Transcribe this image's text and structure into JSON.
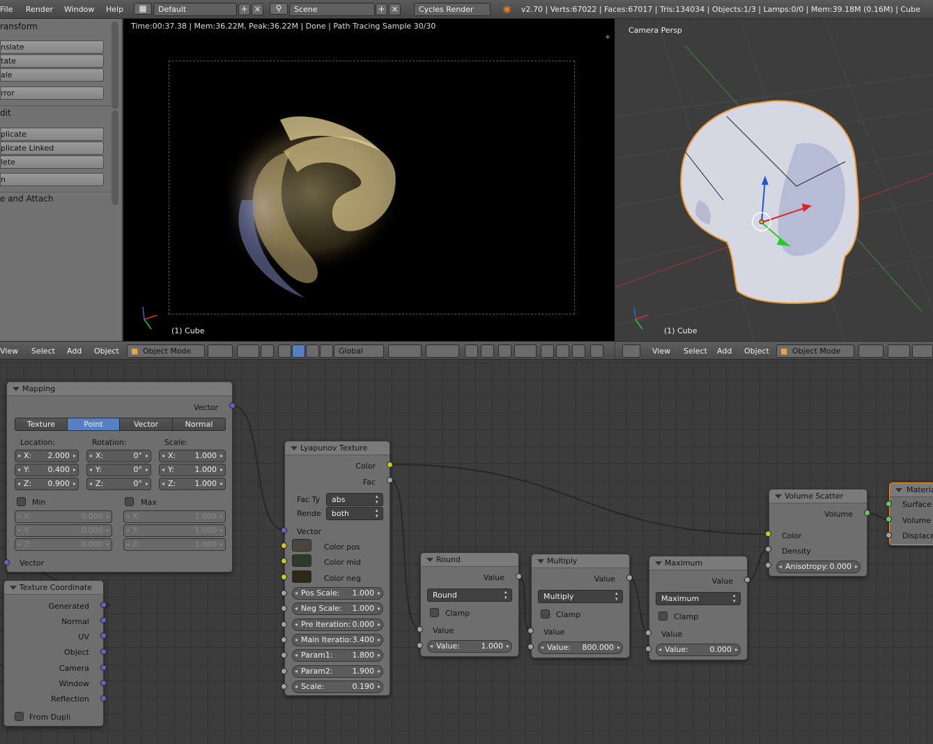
{
  "topbar": {
    "menus": [
      "File",
      "Render",
      "Window",
      "Help"
    ],
    "layout": "Default",
    "scene": "Scene",
    "engine": "Cycles Render",
    "stats": "v2.70 | Verts:67022 | Faces:67017 | Tris:134034 | Objects:1/3 | Lamps:0/0 | Mem:39.18M (0.16M) | Cube"
  },
  "toolshelf": {
    "transform_header": "ransform",
    "transform_buttons": [
      "nslate",
      "tate",
      "ale"
    ],
    "mirror": "rror",
    "edit_header": "dit",
    "edit_buttons": [
      "plicate",
      "plicate Linked",
      "lete"
    ],
    "join": "n",
    "remove_header": "e and Attach"
  },
  "render": {
    "info": "Time:00:37.38 | Mem:36.22M, Peak:36.22M | Done | Path Tracing Sample 30/30",
    "object_label": "(1) Cube"
  },
  "viewport": {
    "label": "Camera Persp",
    "object_label": "(1) Cube"
  },
  "header_left": {
    "menus": [
      "View",
      "Select",
      "Add",
      "Object"
    ],
    "mode": "Object Mode",
    "orientation": "Global"
  },
  "header_right": {
    "menus": [
      "View",
      "Select",
      "Add",
      "Object"
    ],
    "mode": "Object Mode"
  },
  "nodes": {
    "mapping": {
      "title": "Mapping",
      "out_vector": "Vector",
      "tabs": [
        "Texture",
        "Point",
        "Vector",
        "Normal"
      ],
      "active_tab": "Point",
      "location_label": "Location:",
      "rotation_label": "Rotation:",
      "scale_label": "Scale:",
      "loc": [
        [
          "X:",
          "2.000"
        ],
        [
          "Y:",
          "0.400"
        ],
        [
          "Z:",
          "0.900"
        ]
      ],
      "rot": [
        [
          "X:",
          "0°"
        ],
        [
          "Y:",
          "0°"
        ],
        [
          "Z:",
          "0°"
        ]
      ],
      "scl": [
        [
          "X:",
          "1.000"
        ],
        [
          "Y:",
          "1.000"
        ],
        [
          "Z:",
          "1.000"
        ]
      ],
      "min_label": "Min",
      "max_label": "Max",
      "min": [
        [
          "X:",
          "0.000"
        ],
        [
          "Y:",
          "0.000"
        ],
        [
          "Z:",
          "0.000"
        ]
      ],
      "max": [
        [
          "X:",
          "1.000"
        ],
        [
          "Y:",
          "1.000"
        ],
        [
          "Z:",
          "1.000"
        ]
      ],
      "in_vector": "Vector"
    },
    "texcoord": {
      "title": "Texture Coordinate",
      "outputs": [
        "Generated",
        "Normal",
        "UV",
        "Object",
        "Camera",
        "Window",
        "Reflection"
      ],
      "from_dupli": "From Dupli"
    },
    "lyapunov": {
      "title": "Lyapunov Texture",
      "out_color": "Color",
      "out_fac": "Fac",
      "fac_label": "Fac Ty",
      "fac_value": "abs",
      "render_label": "Rende",
      "render_value": "both",
      "in_vector": "Vector",
      "color_pos": "Color pos",
      "color_mid": "Color mid",
      "color_neg": "Color neg",
      "params": [
        [
          "Pos Scale:",
          "1.000"
        ],
        [
          "Neg Scale:",
          "1.000"
        ],
        [
          "Pre Iteration:",
          "0.000"
        ],
        [
          "Main Iteratio:",
          "3.400"
        ],
        [
          "Param1:",
          "1.800"
        ],
        [
          "Param2:",
          "1.900"
        ],
        [
          "Scale:",
          "0.190"
        ]
      ]
    },
    "round": {
      "title": "Round",
      "out": "Value",
      "op": "Round",
      "clamp": "Clamp",
      "in": "Value",
      "field_label": "Value:",
      "field_value": "1.000"
    },
    "multiply": {
      "title": "Multiply",
      "out": "Value",
      "op": "Multiply",
      "clamp": "Clamp",
      "in": "Value",
      "field_label": "Value:",
      "field_value": "800.000"
    },
    "maximum": {
      "title": "Maximum",
      "out": "Value",
      "op": "Maximum",
      "clamp": "Clamp",
      "in": "Value",
      "field_label": "Value:",
      "field_value": "0.000"
    },
    "volscatter": {
      "title": "Volume Scatter",
      "out": "Volume",
      "color": "Color",
      "density": "Density",
      "aniso_label": "Anisotropy:",
      "aniso_value": "0.000"
    },
    "material": {
      "title": "Materia",
      "surface": "Surface",
      "volume": "Volume",
      "displace": "Displace"
    }
  },
  "colors": {
    "socket_vector": "#6363c7",
    "socket_color": "#c7c729",
    "socket_value": "#a1a1a1",
    "socket_shader": "#63c763",
    "active_tab": "#5680c2",
    "selection_outline": "#f09a30"
  }
}
